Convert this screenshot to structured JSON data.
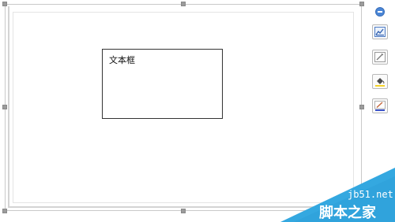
{
  "document": {
    "textbox": {
      "text": "文本框"
    }
  },
  "toolbar": {
    "collapse_icon": "minus-circle-icon",
    "buttons": [
      {
        "name": "layout-options",
        "icon": "layout-options-icon"
      },
      {
        "name": "styles",
        "icon": "pen-style-icon"
      },
      {
        "name": "fill",
        "icon": "fill-bucket-icon",
        "accent": "#f5d32a"
      },
      {
        "name": "outline",
        "icon": "outline-pen-icon",
        "accent": "#3b53c8"
      }
    ]
  },
  "watermark": {
    "url": "jb51.net",
    "brand": "脚本之家",
    "color": "#34a8e0"
  }
}
